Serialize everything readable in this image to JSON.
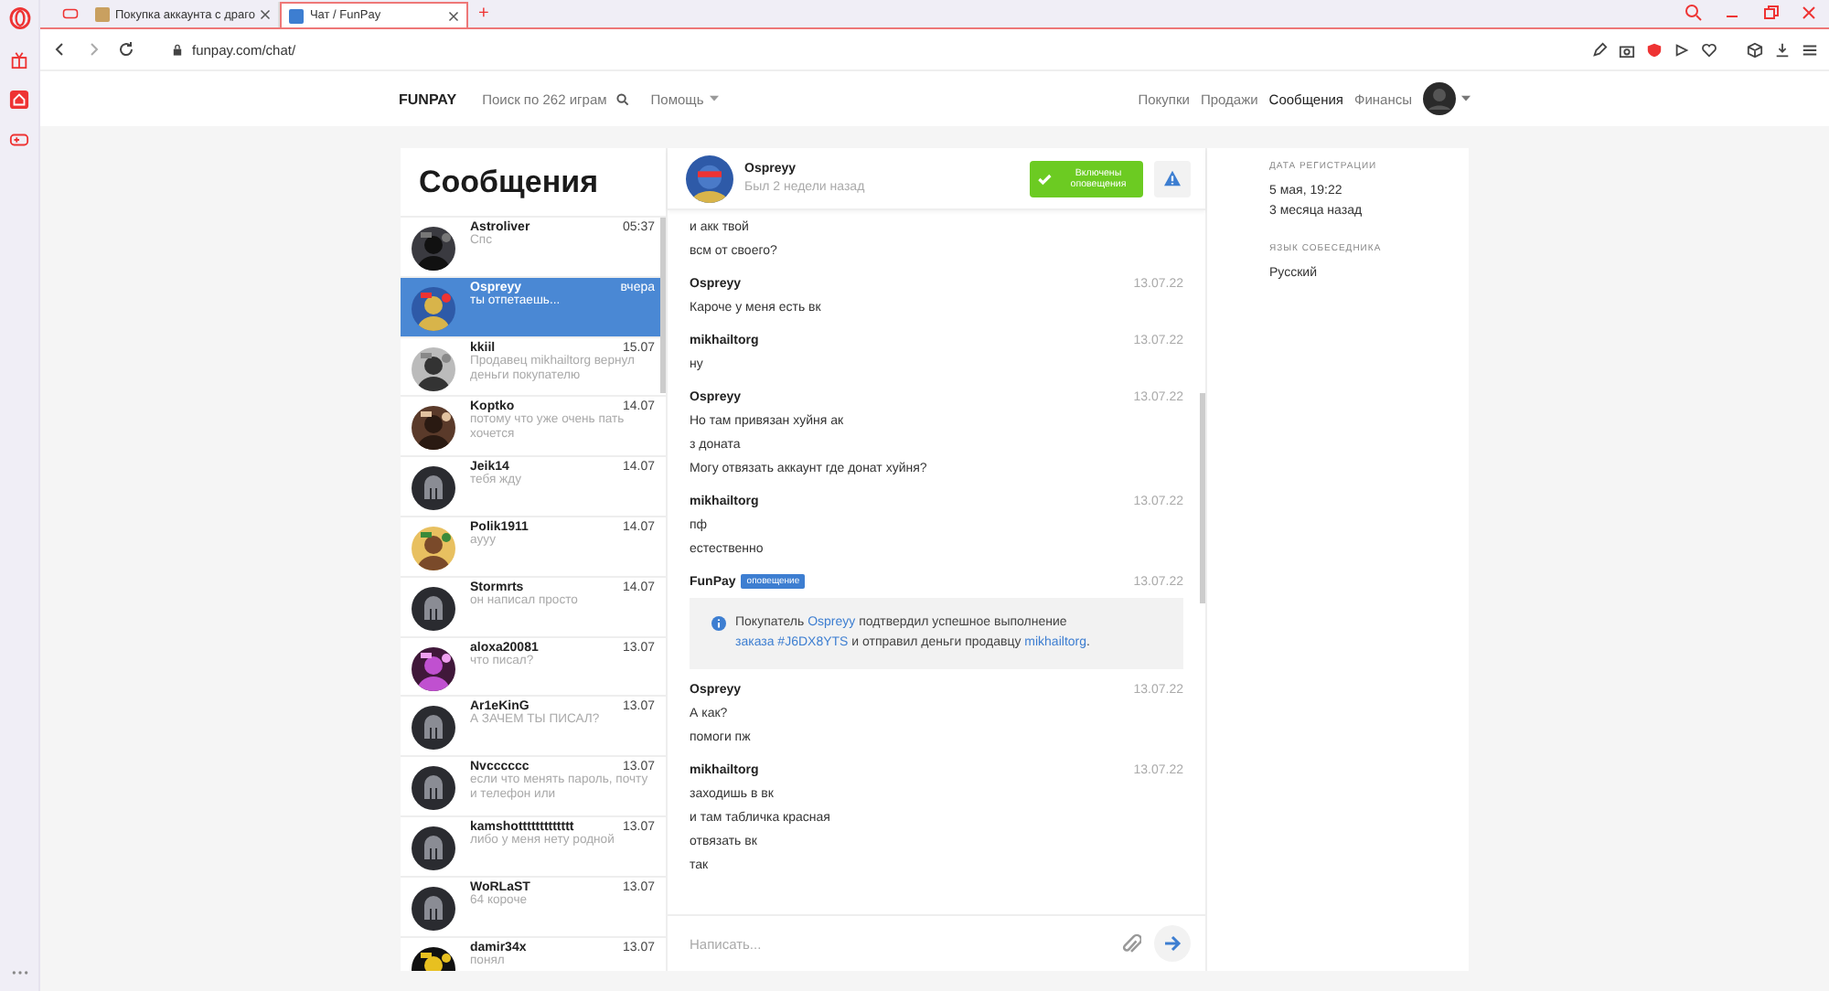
{
  "browser": {
    "tabs": [
      {
        "title": "Покупка аккаунта с драго",
        "selected": false
      },
      {
        "title": "Чат / FunPay",
        "selected": true
      }
    ],
    "new_tab": "+",
    "address": "funpay.com/chat/"
  },
  "site_header": {
    "logo": "FUNPAY",
    "search": "Поиск по 262 играм",
    "help": "Помощь",
    "nav": [
      {
        "label": "Покупки",
        "selected": false
      },
      {
        "label": "Продажи",
        "selected": false
      },
      {
        "label": "Сообщения",
        "selected": true
      },
      {
        "label": "Финансы",
        "selected": false
      }
    ]
  },
  "contacts": {
    "title": "Сообщения",
    "items": [
      {
        "name": "Astroliver",
        "preview": "Спс",
        "time": "05:37",
        "selected": false
      },
      {
        "name": "Ospreyy",
        "preview": "ты отпетаешь...",
        "time": "вчера",
        "selected": true
      },
      {
        "name": "kkiil",
        "preview": "Продавец mikhailtorg вернул деньги покупателю",
        "time": "15.07",
        "selected": false
      },
      {
        "name": "Koptko",
        "preview": "потому что уже очень пать хочется",
        "time": "14.07",
        "selected": false
      },
      {
        "name": "Jeik14",
        "preview": "тебя жду",
        "time": "14.07",
        "kind": "default",
        "selected": false
      },
      {
        "name": "Polik1911",
        "preview": "ayyy",
        "time": "14.07",
        "selected": false
      },
      {
        "name": "Stormrts",
        "preview": "он написал просто",
        "time": "14.07",
        "kind": "default",
        "selected": false
      },
      {
        "name": "aloxa20081",
        "preview": "что писал?",
        "time": "13.07",
        "selected": false
      },
      {
        "name": "Ar1eKinG",
        "preview": "А ЗАЧЕМ ТЫ ПИСАЛ?",
        "time": "13.07",
        "kind": "default",
        "selected": false
      },
      {
        "name": "Nvcccccc",
        "preview": "если что менять пароль, почту и телефон или",
        "time": "13.07",
        "kind": "default",
        "selected": false
      },
      {
        "name": "kamshottttttttttttt",
        "preview": "либо у меня нету родной",
        "time": "13.07",
        "kind": "default",
        "selected": false
      },
      {
        "name": "WoRLaST",
        "preview": "64 короче",
        "time": "13.07",
        "kind": "default",
        "selected": false
      },
      {
        "name": "damir34x",
        "preview": "понял",
        "time": "13.07",
        "selected": false
      }
    ]
  },
  "chat": {
    "header": {
      "name": "Ospreyy",
      "status": "Был 2 недели назад",
      "notify_button": "Включены оповещения"
    },
    "messages": [
      {
        "kind": "message",
        "lines": [
          "и акк твой",
          "всм от своего?"
        ]
      },
      {
        "kind": "message",
        "author": "Ospreyy",
        "date": "13.07.22",
        "lines": [
          "Кароче у меня есть вк"
        ]
      },
      {
        "kind": "message",
        "author": "mikhailtorg",
        "date": "13.07.22",
        "lines": [
          "ну"
        ]
      },
      {
        "kind": "message",
        "author": "Ospreyy",
        "date": "13.07.22",
        "lines": [
          "Но там привязан хуйня ак",
          "з доната",
          "Могу отвязать аккаунт где донат хуйня?"
        ]
      },
      {
        "kind": "message",
        "author": "mikhailtorg",
        "date": "13.07.22",
        "lines": [
          "пф",
          "естественно"
        ]
      },
      {
        "kind": "system",
        "author": "FunPay",
        "badge": "оповещение",
        "date": "13.07.22",
        "parts": [
          {
            "text": "Покупатель ",
            "link": false
          },
          {
            "text": "Ospreyy",
            "link": true
          },
          {
            "text": " подтвердил успешное выполнение ",
            "link": false
          },
          {
            "text": "заказа #J6DX8YTS",
            "link": true
          },
          {
            "text": " и отправил деньги продавцу ",
            "link": false
          },
          {
            "text": "mikhailtorg",
            "link": true
          },
          {
            "text": ".",
            "link": false
          }
        ]
      },
      {
        "kind": "message",
        "author": "Ospreyy",
        "date": "13.07.22",
        "lines": [
          "А как?",
          "помоги пж"
        ]
      },
      {
        "kind": "message",
        "author": "mikhailtorg",
        "date": "13.07.22",
        "lines": [
          "заходишь в вк",
          "и там табличка красная",
          "отвязать вк",
          "так"
        ]
      }
    ],
    "input": {
      "placeholder": "Написать..."
    }
  },
  "info": {
    "fields": [
      {
        "label": "ДАТА РЕГИСТРАЦИИ",
        "lines": [
          "5 мая, 19:22",
          "3 месяца назад"
        ]
      },
      {
        "label": "ЯЗЫК СОБЕСЕДНИКА",
        "lines": [
          "Русский"
        ]
      }
    ]
  }
}
